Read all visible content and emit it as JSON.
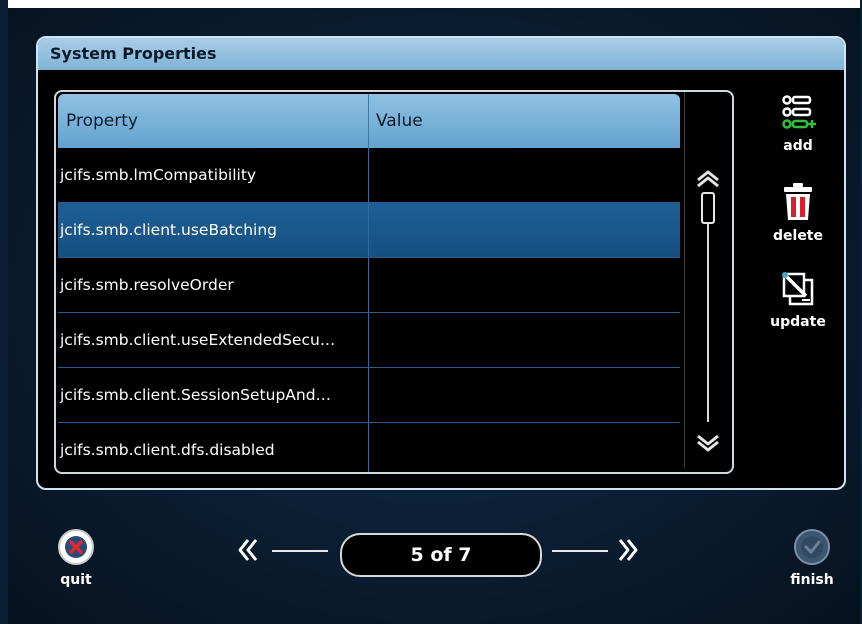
{
  "window": {
    "title": "System Properties"
  },
  "table": {
    "columns": {
      "property": "Property",
      "value": "Value"
    },
    "rows": [
      {
        "property": "jcifs.smb.lmCompatibility",
        "value": ""
      },
      {
        "property": "jcifs.smb.client.useBatching",
        "value": "",
        "selected": true
      },
      {
        "property": "jcifs.smb.resolveOrder",
        "value": ""
      },
      {
        "property": "jcifs.smb.client.useExtendedSecu…",
        "value": ""
      },
      {
        "property": "jcifs.smb.client.SessionSetupAnd…",
        "value": ""
      },
      {
        "property": "jcifs.smb.client.dfs.disabled",
        "value": ""
      }
    ]
  },
  "tools": {
    "add": "add",
    "delete": "delete",
    "update": "update"
  },
  "nav": {
    "quit": "quit",
    "finish": "finish",
    "page_indicator": "5 of 7"
  },
  "colors": {
    "selection": "#1d5f95",
    "header": "#8fc1e3",
    "delete_red": "#d8202a",
    "add_green": "#2fbf3a"
  }
}
